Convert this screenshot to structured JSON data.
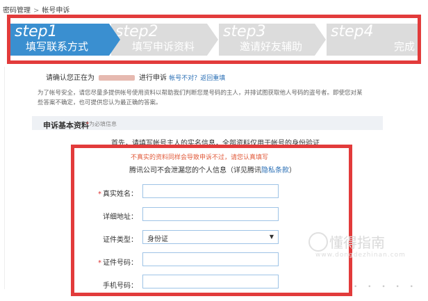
{
  "breadcrumb": {
    "root": "密码管理",
    "separator": ">",
    "current": "帐号申诉"
  },
  "steps": [
    {
      "num": "step1",
      "title": "填写联系方式",
      "active": true
    },
    {
      "num": "step2",
      "title": "填写申诉资料",
      "active": false
    },
    {
      "num": "step3",
      "title": "邀请好友辅助",
      "active": false
    },
    {
      "num": "step4",
      "title": "完成",
      "active": false
    }
  ],
  "confirm": {
    "prefix": "请确认您正在为",
    "suffix": "进行申诉",
    "link": "帐号不对？返回重填"
  },
  "notice": "为了帐号安全，请您尽量多提供帐号使用资料以帮助我们判断您是号码的主人，并排试图获取他人号码的盗号者。即使您对某些答案不确定，也可提供您认为最正确的答案。",
  "section": {
    "title": "申诉基本资料",
    "required_star": "*",
    "required_note": "为必填信息"
  },
  "intro": "首先，请填写帐号主人的实名信息，全部资料仅用于帐号的身份验证",
  "warning": "不真实的资料同样会导致申诉不过，请您认真填写",
  "privacy": {
    "prefix": "腾讯公司不会泄漏您的个人信息（详见腾讯",
    "link": "隐私条款",
    "suffix": "）"
  },
  "form": {
    "real_name": {
      "label": "真实姓名：",
      "required": "*",
      "value": ""
    },
    "address": {
      "label": "详细地址：",
      "value": ""
    },
    "id_type": {
      "label": "证件类型：",
      "value": "身份证"
    },
    "id_number": {
      "label": "证件号码：",
      "required": "*",
      "value": ""
    },
    "phone": {
      "label": "手机号码：",
      "value": ""
    }
  },
  "watermark": {
    "text": "懂得指南",
    "sub": "www.dongdezhinan.com"
  },
  "colors": {
    "accent": "#3a8fd0",
    "highlight_border": "#e23b3b",
    "warning": "#e15a3a",
    "link": "#2a6fb5"
  }
}
